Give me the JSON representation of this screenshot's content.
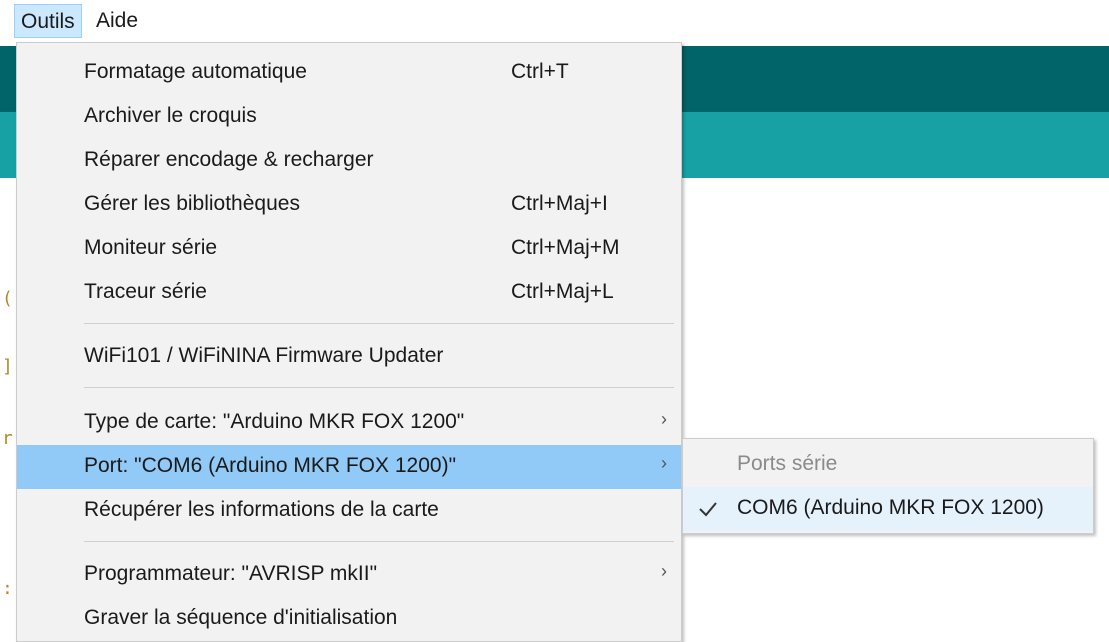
{
  "menubar": {
    "items": [
      {
        "label": "Outils",
        "active": true
      },
      {
        "label": "Aide",
        "active": false
      }
    ]
  },
  "colors": {
    "toolbar_dark": "#006468",
    "toolbar_teal": "#17a1a5",
    "menu_bg": "#f2f2f2",
    "highlight": "#91c9f7"
  },
  "tools_menu": {
    "items": [
      {
        "label": "Formatage automatique",
        "shortcut": "Ctrl+T"
      },
      {
        "label": "Archiver le croquis",
        "shortcut": ""
      },
      {
        "label": "Réparer encodage & recharger",
        "shortcut": ""
      },
      {
        "label": "Gérer les bibliothèques",
        "shortcut": "Ctrl+Maj+I"
      },
      {
        "label": "Moniteur série",
        "shortcut": "Ctrl+Maj+M"
      },
      {
        "label": "Traceur série",
        "shortcut": "Ctrl+Maj+L"
      },
      {
        "label": "WiFi101 / WiFiNINA Firmware Updater",
        "shortcut": ""
      },
      {
        "label": "Type de carte: \"Arduino MKR FOX 1200\"",
        "submenu": true
      },
      {
        "label": "Port: \"COM6 (Arduino MKR FOX 1200)\"",
        "submenu": true,
        "highlighted": true
      },
      {
        "label": "Récupérer les informations de la carte",
        "shortcut": ""
      },
      {
        "label": "Programmateur: \"AVRISP mkII\"",
        "submenu": true
      },
      {
        "label": "Graver la séquence d'initialisation",
        "shortcut": ""
      }
    ]
  },
  "port_submenu": {
    "header": "Ports série",
    "items": [
      {
        "label": "COM6 (Arduino MKR FOX 1200)",
        "checked": true
      }
    ]
  }
}
